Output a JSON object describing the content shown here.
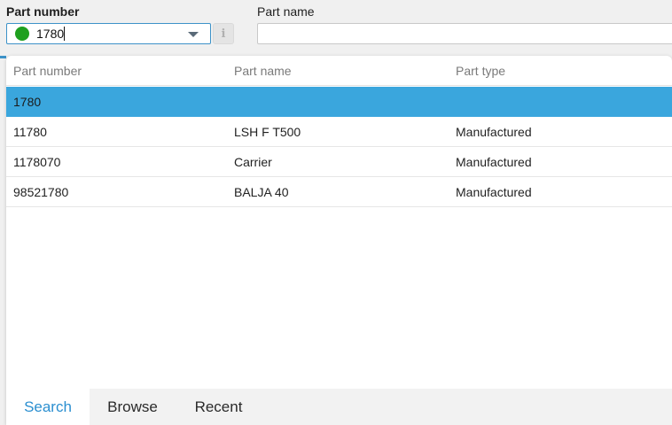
{
  "form": {
    "part_number_label": "Part number",
    "part_name_label": "Part name",
    "part_number_value": "1780",
    "part_name_value": ""
  },
  "colors": {
    "status_dot": "#1fa01f",
    "selection": "#3aa6dd",
    "accent": "#2b8fd0"
  },
  "icons": {
    "status": "green-circle-icon",
    "dropdown": "chevron-down-icon",
    "info": "info-icon"
  },
  "results": {
    "columns": [
      "Part number",
      "Part name",
      "Part type"
    ],
    "rows": [
      {
        "part_number": "1780",
        "part_name": "",
        "part_type": "",
        "selected": true
      },
      {
        "part_number": "11780",
        "part_name": "LSH F T500",
        "part_type": "Manufactured",
        "selected": false
      },
      {
        "part_number": "1178070",
        "part_name": "Carrier",
        "part_type": "Manufactured",
        "selected": false
      },
      {
        "part_number": "98521780",
        "part_name": "BALJA 40",
        "part_type": "Manufactured",
        "selected": false
      }
    ]
  },
  "tabs": [
    {
      "label": "Search",
      "active": true
    },
    {
      "label": "Browse",
      "active": false
    },
    {
      "label": "Recent",
      "active": false
    }
  ]
}
